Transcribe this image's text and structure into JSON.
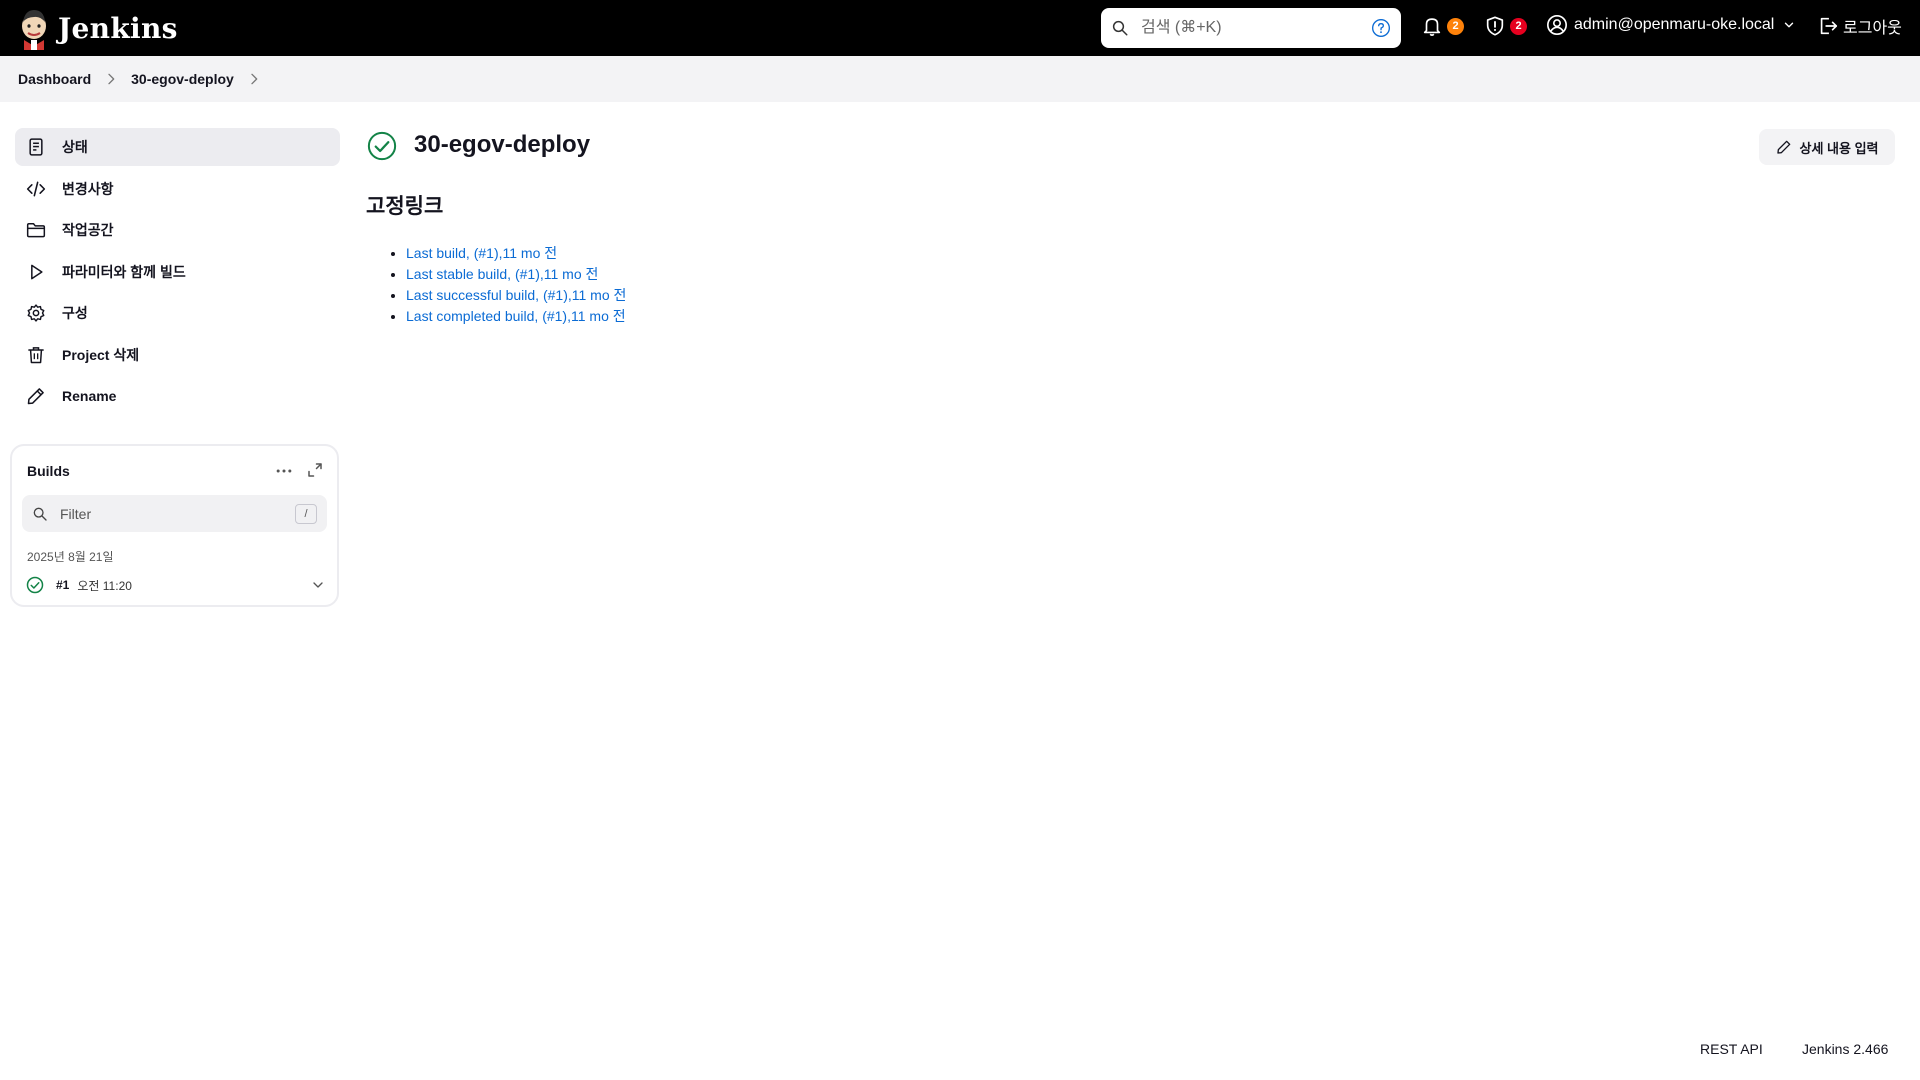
{
  "header": {
    "app_name": "Jenkins",
    "search": {
      "placeholder": "검색 (⌘+K)"
    },
    "notifications": {
      "count": "2"
    },
    "security": {
      "count": "2"
    },
    "user": {
      "name": "admin@openmaru-oke.local"
    },
    "logout_label": "로그아웃"
  },
  "breadcrumb": {
    "items": [
      "Dashboard",
      "30-egov-deploy"
    ]
  },
  "sidebar": {
    "items": [
      {
        "label": "상태",
        "icon": "document-icon"
      },
      {
        "label": "변경사항",
        "icon": "code-icon"
      },
      {
        "label": "작업공간",
        "icon": "folder-icon"
      },
      {
        "label": "파라미터와 함께 빌드",
        "icon": "play-icon"
      },
      {
        "label": "구성",
        "icon": "gear-icon"
      },
      {
        "label": "Project 삭제",
        "icon": "trash-icon"
      },
      {
        "label": "Rename",
        "icon": "pencil-icon"
      }
    ]
  },
  "builds": {
    "title": "Builds",
    "filter_placeholder": "Filter",
    "filter_shortcut": "/",
    "date": "2025년 8월 21일",
    "rows": [
      {
        "number": "#1",
        "time": "오전 11:20"
      }
    ]
  },
  "main": {
    "title": "30-egov-deploy",
    "edit_button": "상세 내용 입력",
    "section_title": "고정링크",
    "permalinks": [
      "Last build, (#1),11 mo 전",
      "Last stable build, (#1),11 mo 전",
      "Last successful build, (#1),11 mo 전",
      "Last completed build, (#1),11 mo 전"
    ]
  },
  "footer": {
    "rest_api": "REST API",
    "version": "Jenkins 2.466"
  },
  "colors": {
    "header_bg": "#000000",
    "link": "#0b6bd4",
    "success": "#138347",
    "badge_orange": "#fe820a",
    "badge_red": "#e6001f"
  }
}
